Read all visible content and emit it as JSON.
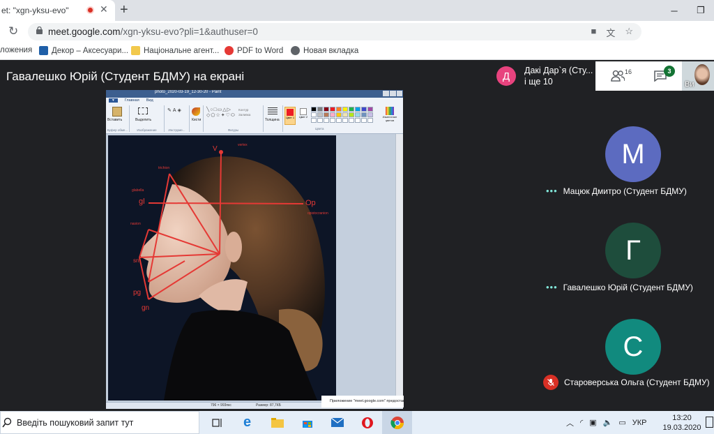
{
  "browser": {
    "tab_title": "et: \"xgn-yksu-evo\"",
    "url_host": "meet.google.com",
    "url_path": "/xgn-yksu-evo?pli=1&authuser=0",
    "bookmarks": [
      "ложения",
      "Декор – Аксесуари...",
      "Національне агент...",
      "PDF to Word",
      "Новая вкладка"
    ]
  },
  "meet": {
    "presenter_title": "Гавалешко Юрій (Студент БДМУ) на екрані",
    "pinned": {
      "initial": "Д",
      "name": "Дакі Дар`я (Сту...",
      "sub": "і ще 10"
    },
    "people_count": "16",
    "chat_badge": "3",
    "self_label": "Ви",
    "participants": [
      {
        "initial": "М",
        "name": "Мацюк Дмитро (Студент БДМУ)",
        "color": "#5c6bc0",
        "status": "speaking"
      },
      {
        "initial": "Г",
        "name": "Гавалешко Юрій (Студент БДМУ)",
        "color": "#1e4d3c",
        "status": "speaking"
      },
      {
        "initial": "С",
        "name": "Староверська Ольга (Студент БДМУ)",
        "color": "#118a7e",
        "status": "muted"
      }
    ]
  },
  "shared_screen": {
    "paint_title": "photo_2020-03-19_12-30-20 - Paint",
    "ribbon_tabs": [
      "Главная",
      "Вид"
    ],
    "groups": [
      "Буфер обме...",
      "Изображение",
      "Инструме...",
      "Фигуры",
      "Цвета"
    ],
    "buttons": {
      "paste": "Вставить",
      "select": "Выделить",
      "brushes": "Кисти",
      "thickness": "Толщина",
      "color1": "Цвет 1",
      "color2": "Цвет 2",
      "edit_colors": "Изменение цветов",
      "outline": "Контур",
      "fill": "Заливка"
    },
    "status_zoom": "796 × 993пкс",
    "status_size": "Размер: 87,7КБ",
    "toast": "Приложение \"meet.google.com\" предоставляет доступ",
    "annotations": [
      "vertex",
      "trichion",
      "glabella",
      "nasion",
      "opistocranion",
      "Op",
      "V",
      "gl",
      "pg",
      "gn",
      "sn"
    ]
  },
  "taskbar": {
    "search_text": "Введіть пошуковий запит тут",
    "lang": "УКР",
    "time": "13:20",
    "date": "19.03.2020"
  },
  "palette_colors": [
    "#000000",
    "#7f7f7f",
    "#880015",
    "#ed1c24",
    "#ff7f27",
    "#fff200",
    "#22b14c",
    "#00a2e8",
    "#3f48cc",
    "#a349a4",
    "#ffffff",
    "#c3c3c3",
    "#b97a57",
    "#ffaec9",
    "#ffc90e",
    "#efe4b0",
    "#b5e61d",
    "#99d9ea",
    "#7092be",
    "#c8bfe7",
    "#ffffff",
    "#ffffff",
    "#ffffff",
    "#ffffff",
    "#ffffff",
    "#ffffff",
    "#ffffff",
    "#ffffff",
    "#ffffff",
    "#ffffff"
  ]
}
